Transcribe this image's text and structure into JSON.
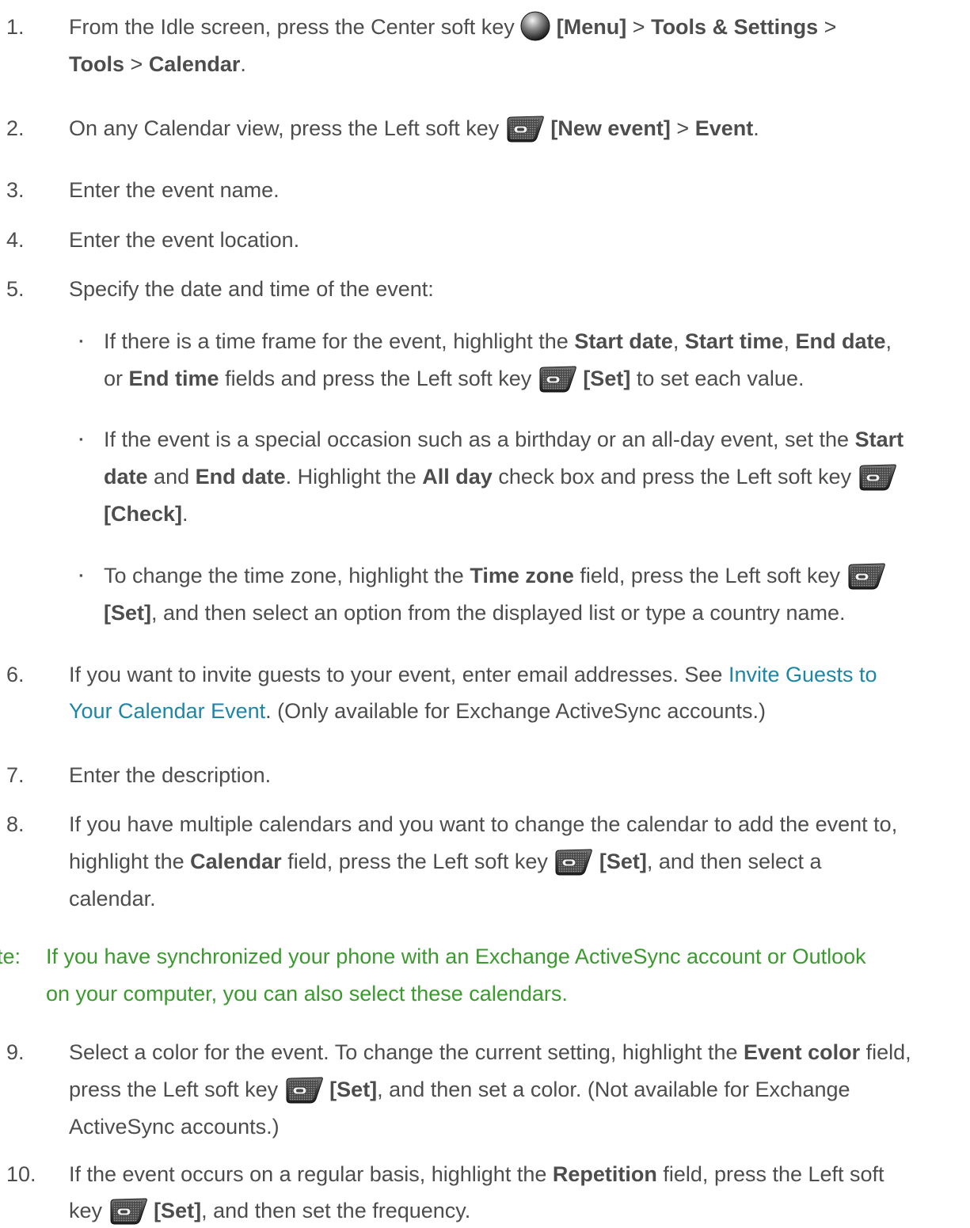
{
  "steps": [
    {
      "number": "1.",
      "l1": [
        "From the Idle screen, press the Center soft key",
        "[Menu]",
        ">",
        "Tools & Settings",
        ">"
      ],
      "l2": [
        "Tools",
        ">",
        "Calendar",
        "."
      ]
    },
    {
      "number": "2.",
      "l1": [
        "On any Calendar view, press the Left soft key",
        "[New event]",
        ">",
        "Event",
        "."
      ]
    },
    {
      "number": "3.",
      "text": "Enter the event name."
    },
    {
      "number": "4.",
      "text": "Enter the event location."
    },
    {
      "number": "5.",
      "text": "Specify the date and time of the event:"
    },
    {
      "number": "6.",
      "l1": [
        "If you want to invite guests to your event, enter email addresses. See",
        "Invite Guests to"
      ],
      "l2": [
        "Your Calendar Event",
        ". (Only available for Exchange ActiveSync accounts.)"
      ]
    },
    {
      "number": "7.",
      "text": "Enter the description."
    },
    {
      "number": "8.",
      "l1": [
        "If you have multiple calendars and you want to change the calendar to add the event to,"
      ],
      "l2": [
        "highlight the",
        "Calendar",
        "field, press the Left soft key",
        "[Set]",
        ", and then select a"
      ],
      "l3": [
        "calendar."
      ]
    },
    {
      "number": "9.",
      "l1": [
        "Select a color for the event. To change the current setting, highlight the",
        "Event color",
        "field,"
      ],
      "l2": [
        "press the Left soft key",
        "[Set]",
        ", and then set a color. (Not available for Exchange"
      ],
      "l3": [
        "ActiveSync accounts.)"
      ]
    },
    {
      "number": "10.",
      "l1": [
        "If the event occurs on a regular basis, highlight the",
        "Repetition",
        "field, press the Left soft"
      ],
      "l2": [
        "key",
        "[Set]",
        ", and then set the frequency."
      ]
    }
  ],
  "bullets": [
    {
      "l1": [
        "If there is a time frame for the event, highlight the",
        "Start date",
        ",",
        "Start time",
        ",",
        "End date",
        ","
      ],
      "l2": [
        "or",
        "End time",
        "fields and press the Left soft key",
        "[Set]",
        "to set each value."
      ]
    },
    {
      "l1": [
        "If the event is a special occasion such as a birthday or an all-day event, set the",
        "Start"
      ],
      "l2": [
        "date",
        "and",
        "End date",
        ". Highlight the",
        "All day",
        "check box and press the Left soft key"
      ],
      "l3": [
        "[Check]",
        "."
      ]
    },
    {
      "l1": [
        "To change the time zone, highlight the",
        "Time zone",
        "field, press the Left soft key"
      ],
      "l2": [
        "[Set]",
        ", and then select an option from the displayed list or type a country name."
      ]
    }
  ],
  "bullet_symbol": "▪",
  "note": {
    "label": "te:",
    "l1": "If you have synchronized your phone with an Exchange ActiveSync account or Outlook",
    "l2": "on your computer, you can also select these calendars."
  },
  "icons": {
    "center_key": "center-soft-key-icon",
    "left_key": "left-soft-key-icon"
  },
  "colors": {
    "text": "#4d4d4d",
    "link": "#1d86a5",
    "note": "#3a9a2e"
  }
}
